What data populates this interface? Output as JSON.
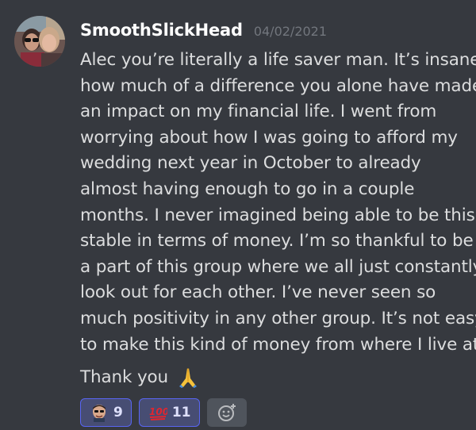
{
  "message": {
    "author": "SmoothSlickHead",
    "timestamp": "04/02/2021",
    "avatar_icon": "user-avatar-photo",
    "lines": [
      "Alec you’re literally a life saver man. It’s insane",
      "how much of a difference you alone have made",
      "an impact on my financial life. I went from",
      "worrying about how I was going to afford my",
      "wedding next year in October to already",
      "almost having enough to go in a couple",
      "months. I never imagined being able to be this",
      "stable in terms of money. I’m so thankful to be",
      "a part of this group where we all just constantly",
      "look out for each other. I’ve never seen so",
      "much positivity in any other group. It’s not easy",
      "to make this kind of money from where I live at."
    ],
    "closing": "Thank you",
    "closing_emoji": "folded-hands-emoji"
  },
  "reactions": [
    {
      "icon": "custom-face-emoji",
      "count": "9"
    },
    {
      "icon": "hundred-points-emoji",
      "count": "11"
    }
  ],
  "add_reaction_icon": "add-reaction-icon",
  "colors": {
    "background": "#36393f",
    "username": "#ffffff",
    "timestamp": "#72767d",
    "text": "#dcddde",
    "reaction_active_bg": "#474d73",
    "reaction_active_border": "#5865f2",
    "add_reaction_bg": "#4f545c"
  }
}
